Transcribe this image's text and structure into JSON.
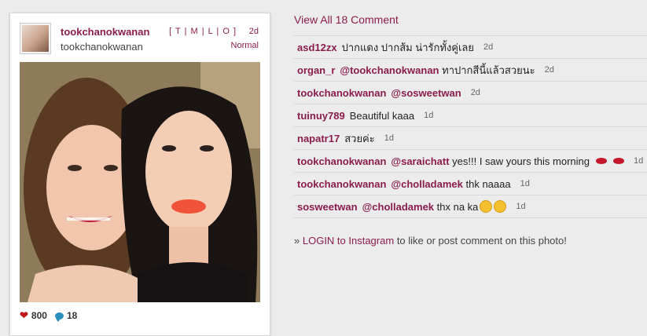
{
  "post": {
    "username": "tookchanokwanan",
    "full_name": "tookchanokwanan",
    "sizes": "[ T | M | L | O ]",
    "age": "2d",
    "filter": "Normal",
    "likes": "800",
    "comments_count": "18"
  },
  "comments": {
    "view_all": "View All 18 Comment",
    "items": [
      {
        "user": "asd12zx",
        "text": "ปากแดง ปากส้ม น่ารักทั้งคู่เลย",
        "time": "2d"
      },
      {
        "user": "organ_r",
        "mention": "@tookchanokwanan",
        "text": "ทาปากสีนี้แล้วสวยนะ",
        "time": "2d"
      },
      {
        "user": "tookchanokwanan",
        "mention": "@sosweetwan",
        "text": "",
        "time": "2d"
      },
      {
        "user": "tuinuy789",
        "text": "Beautiful kaaa",
        "time": "1d"
      },
      {
        "user": "napatr17",
        "text": "สวยค่ะ",
        "time": "1d"
      },
      {
        "user": "tookchanokwanan",
        "mention": "@saraichatt",
        "text": "yes!!! I saw yours this morning",
        "time": "1d"
      },
      {
        "user": "tookchanokwanan",
        "mention": "@cholladamek",
        "text": "thk naaaa",
        "time": "1d"
      },
      {
        "user": "sosweetwan",
        "mention": "@cholladamek",
        "text": "thx na ka",
        "time": "1d"
      }
    ]
  },
  "login": {
    "prefix": "»",
    "link": "LOGIN to Instagram",
    "suffix": "to like or post comment on this photo!"
  },
  "icons": {
    "heart": "heart-icon",
    "comment": "comment-bubble-icon",
    "lips": "lips-emoji",
    "wink": "wink-emoji"
  },
  "colors": {
    "accent": "#8b1d4c",
    "background": "#ececec"
  }
}
